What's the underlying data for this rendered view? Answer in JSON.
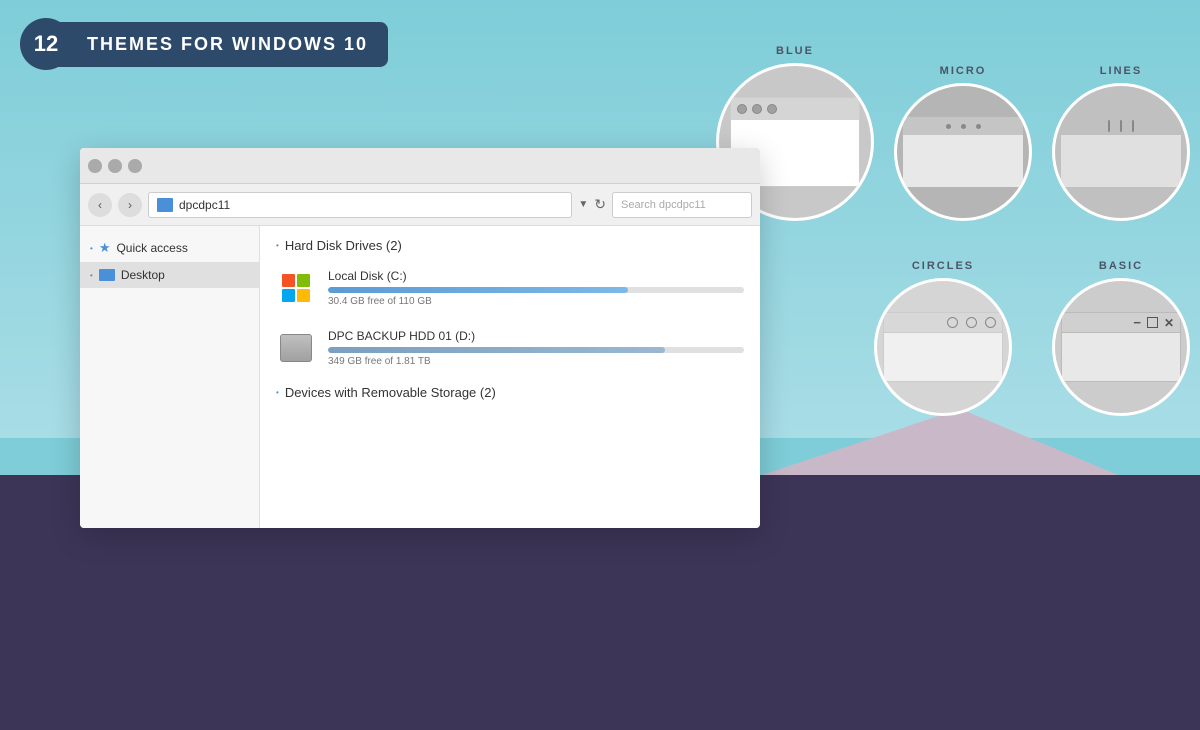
{
  "logo": {
    "number": "12",
    "title": "THEMES FOR WINDOWS 10"
  },
  "themes": {
    "row1": [
      {
        "id": "blue",
        "label": "BLUE"
      },
      {
        "id": "micro",
        "label": "MICRO"
      },
      {
        "id": "lines",
        "label": "LINES"
      }
    ],
    "row2": [
      {
        "id": "circles",
        "label": "CIRCLES"
      },
      {
        "id": "basic",
        "label": "BASIC"
      }
    ]
  },
  "explorer": {
    "address": "dpcdpc11",
    "search_placeholder": "Search dpcdpc11",
    "sidebar": {
      "items": [
        {
          "id": "quick-access",
          "label": "Quick access",
          "type": "star",
          "bullet": "•"
        },
        {
          "id": "desktop",
          "label": "Desktop",
          "type": "desktop",
          "bullet": "•"
        }
      ]
    },
    "main": {
      "sections": [
        {
          "id": "hard-disk-drives",
          "header": "Hard Disk Drives (2)",
          "bullet": "•",
          "drives": [
            {
              "id": "local-disk-c",
              "name": "Local Disk (C:)",
              "free": "30.4 GB free of 110 GB",
              "progress": 72,
              "type": "windows"
            },
            {
              "id": "dpc-backup-d",
              "name": "DPC BACKUP HDD 01 (D:)",
              "free": "349 GB free of 1.81 TB",
              "progress": 81,
              "type": "hdd"
            }
          ]
        },
        {
          "id": "removable-storage",
          "header": "Devices with Removable Storage (2)",
          "bullet": "•",
          "drives": []
        }
      ]
    }
  }
}
